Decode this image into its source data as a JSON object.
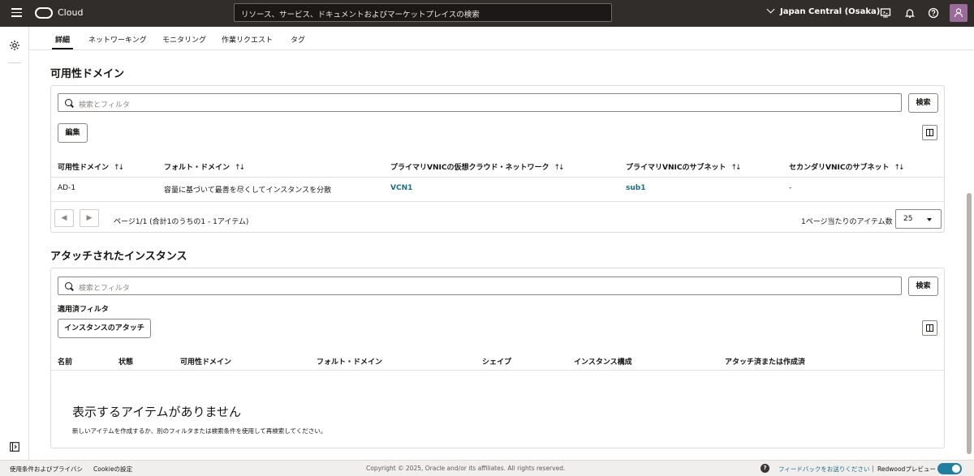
{
  "header": {
    "brand": "Cloud",
    "search_value": "リソース、サービス、ドキュメントおよびマーケットプレイスの検索",
    "region": "Japan Central (Osaka)"
  },
  "tabs": [
    {
      "label": "詳細",
      "active": true
    },
    {
      "label": "ネットワーキング",
      "active": false
    },
    {
      "label": "モニタリング",
      "active": false
    },
    {
      "label": "作業リクエスト",
      "active": false
    },
    {
      "label": "タグ",
      "active": false
    }
  ],
  "availability": {
    "title": "可用性ドメイン",
    "filter_placeholder": "検索とフィルタ",
    "search_button": "検索",
    "edit_button": "編集",
    "columns": [
      "可用性ドメイン",
      "フォルト・ドメイン",
      "プライマリVNICの仮想クラウド・ネットワーク",
      "プライマリVNICのサブネット",
      "セカンダリVNICのサブネット"
    ],
    "rows": [
      {
        "ad": "AD-1",
        "fd": "容量に基づいて最善を尽くしてインスタンスを分散",
        "vcn": "VCN1",
        "subnet": "sub1",
        "secondary": "-"
      }
    ],
    "pagination_text": "ページ1/1 (合計1のうちの1 - 1アイテム)",
    "per_page_label": "1ページ当たりのアイテム数",
    "per_page_value": "25"
  },
  "attached": {
    "title": "アタッチされたインスタンス",
    "filter_placeholder": "検索とフィルタ",
    "search_button": "検索",
    "applied_filter_label": "適用済フィルタ",
    "attach_button": "インスタンスのアタッチ",
    "columns": [
      "名前",
      "状態",
      "可用性ドメイン",
      "フォルト・ドメイン",
      "シェイプ",
      "インスタンス構成",
      "アタッチ済または作成済"
    ],
    "empty_title": "表示するアイテムがありません",
    "empty_sub": "新しいアイテムを作成するか、別のフィルタまたは検索条件を使用して再検索してください。"
  },
  "footer": {
    "terms": "使用条件およびプライバシ",
    "cookie": "Cookieの設定",
    "copyright": "Copyright © 2025, Oracle and/or its affiliates. All rights reserved.",
    "help": "?",
    "feedback": "フィードバックをお送りください",
    "separator": "|",
    "redwood": "Redwoodプレビュー"
  }
}
